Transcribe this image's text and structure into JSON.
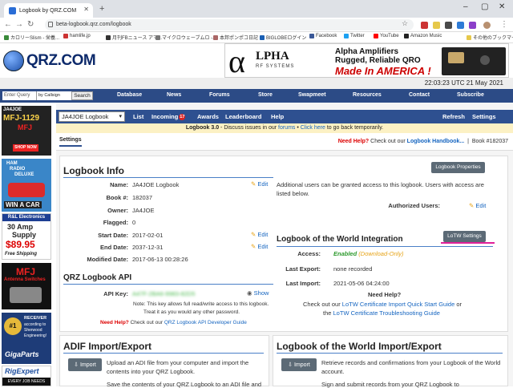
{
  "browser": {
    "tab_title": "Logbook by QRZ.COM",
    "url": "beta-logbook.qrz.com/logbook",
    "bookmarks": [
      "カロリーSlism - 栄養...",
      "hamlife.jp",
      "月刊FBニュース アマ...",
      "マイクロウェーブムロ -...",
      "本邦ポンポコ日記",
      "BIGLOBEログイン",
      "Facebook",
      "Twitter",
      "YouTube",
      "Amazon Music",
      "その他のブックマーク"
    ]
  },
  "site": {
    "logo": "QRZ.COM",
    "timestamp": "22:03:23 UTC 21 May 2021",
    "ad": {
      "line1": "Alpha Amplifiers",
      "line2": "Rugged, Reliable QRO",
      "line3": "Made In AMERICA !",
      "brand": "LPHA",
      "sub": "RF SYSTEMS"
    },
    "search_placeholder": "Enter Query",
    "search_select": "by Callsign",
    "search_button": "Search",
    "menu": [
      "Database",
      "News",
      "Forums",
      "Store",
      "Swapmeet",
      "Resources",
      "Contact",
      "Subscribe"
    ]
  },
  "left_ads": {
    "a1_call": "JA4JOE",
    "a1_title": "MFJ-1129",
    "a1_brand": "MFJ",
    "a1_btn": "SHOP NOW",
    "a2_line1": "HAM",
    "a2_line2": "RADIO",
    "a2_line3": "DELUXE",
    "a2_win": "WIN A CAR",
    "a3_brand": "R&L Electronics",
    "a3_line1": "30 Amp",
    "a3_line2": "Supply",
    "a3_price": "$89.95",
    "a3_ship": "Free Shipping",
    "a4_brand": "MFJ",
    "a4_sub": "Antenna Switches",
    "a5_num": "#1",
    "a5_l1": "RECEIVER",
    "a5_l2": "according to",
    "a5_l3": "Sherwood",
    "a5_l4": "Engineering!",
    "a5_brand": "GigaParts",
    "a6_brand": "RigExpert",
    "a6_sub": "EVERY JOB NEEDS"
  },
  "logbook_bar": {
    "selected": "JA4JOE Logbook",
    "items": [
      "List",
      "Incoming",
      "Awards",
      "Leaderboard",
      "Help"
    ],
    "incoming_count": "17",
    "right": [
      "Refresh",
      "Settings"
    ]
  },
  "notice": {
    "prefix": "Logbook 3.0",
    "text1": " - Discuss issues in our ",
    "forums": "forums",
    "text2": " • ",
    "click": "Click here",
    "text3": " to go back temporarily."
  },
  "tabs": {
    "settings": "Settings",
    "need_help": "Need Help?",
    "checkout": " Check out our ",
    "handbook": "Logbook Handbook...",
    "book_no": "Book #182037"
  },
  "logbook_info": {
    "title": "Logbook Info",
    "properties_btn": "Logbook Properties",
    "edit": "Edit",
    "rows": [
      {
        "label": "Name:",
        "value": "JA4JOE Logbook"
      },
      {
        "label": "Book #:",
        "value": "182037"
      },
      {
        "label": "Owner:",
        "value": "JA4JOE"
      },
      {
        "label": "Flagged:",
        "value": "0"
      },
      {
        "label": "Start Date:",
        "value": "2017-02-01"
      },
      {
        "label": "End Date:",
        "value": "2037-12-31"
      },
      {
        "label": "Modified Date:",
        "value": "2017-06-13 00:28:26"
      }
    ],
    "users_text": "Additional users can be granted access to this logbook. Users with access are listed below.",
    "authorized_label": "Authorized Users:"
  },
  "api": {
    "title": "QRZ Logbook API",
    "key_label": "API Key:",
    "key_value": "A47F-2BA6-9983-82D5",
    "show": "Show",
    "note1": "Note: This key allows full read/write access to this logbook.",
    "note2": "Treat it as you would any other password.",
    "need_help": "Need Help?",
    "checkout": " Check out our ",
    "link": "QRZ Logbook API Developer Guide"
  },
  "lotw": {
    "title": "Logbook of the World Integration",
    "settings_btn": "LoTW Settings",
    "rows": [
      {
        "label": "Access:",
        "value": "Enabled",
        "extra": "(Download-Only)"
      },
      {
        "label": "Last Export:",
        "value": "none recorded"
      },
      {
        "label": "Last Import:",
        "value": "2021-05-06 04:24:00"
      }
    ],
    "need_help": "Need Help?",
    "checkout": "Check out our ",
    "link1": "LoTW Certificate Import Quick Start Guide",
    "or": " or",
    "the": "the ",
    "link2": "LoTW Certificate Troubleshooting Guide"
  },
  "adif": {
    "title": "ADIF Import/Export",
    "import_btn": "Import",
    "text": "Upload an ADI file from your computer and import the contents into your QRZ Logbook.",
    "text2": "Save the contents of your QRZ Logbook to an ADI file and"
  },
  "lotw_ie": {
    "title": "Logbook of the World Import/Export",
    "import_btn": "Import",
    "text": "Retrieve records and confirmations from your Logbook of the World account.",
    "text2": "Sign and submit records from your QRZ Logbook to"
  },
  "colors": {
    "menu": "#2c4b86",
    "lbbar": "#2e5090",
    "accent": "#1565c0",
    "enabled": "#2e9a2e",
    "magenta": "#e0209a"
  }
}
